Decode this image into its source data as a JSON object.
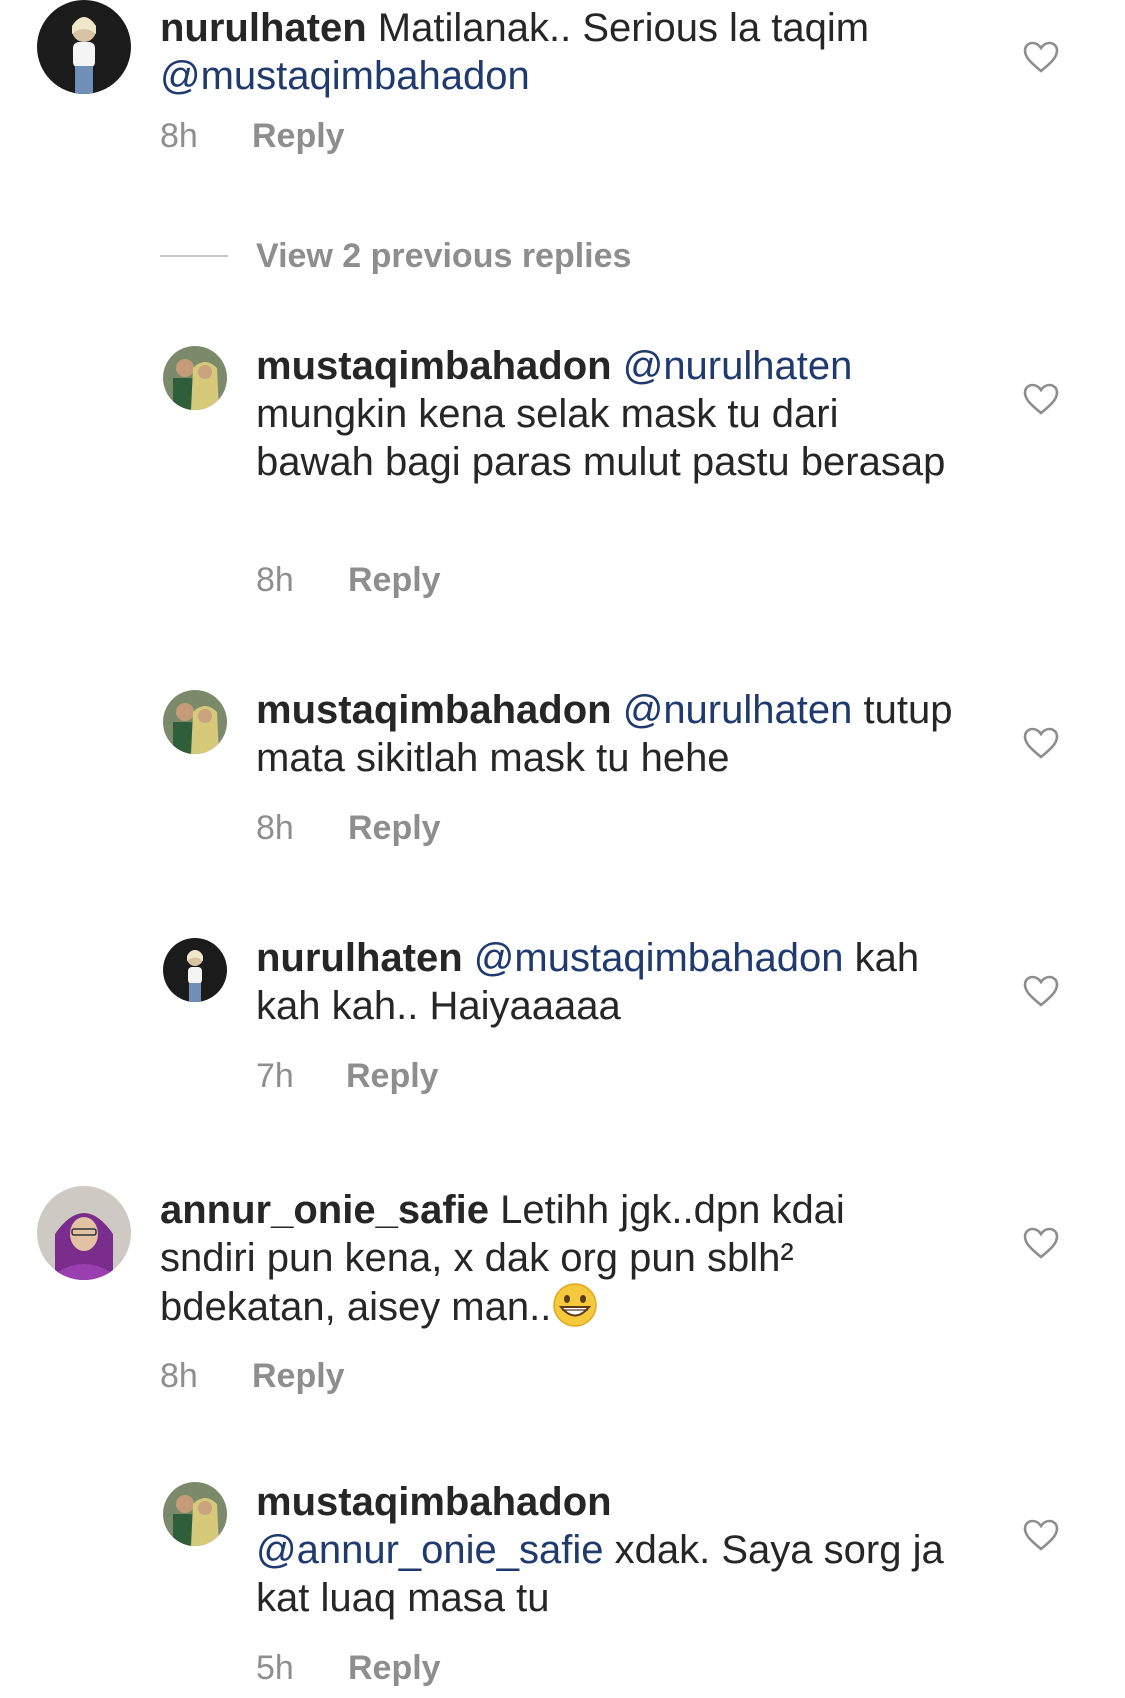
{
  "comments": [
    {
      "user": "nurulhaten",
      "text_before": " Matilanak.. Serious la taqim ",
      "mention": "@mustaqimbahadon",
      "text_after": "",
      "time": "8h",
      "reply": "Reply"
    }
  ],
  "view_previous": "View 2 previous replies",
  "replies": [
    {
      "user": "mustaqimbahadon",
      "mention": " @nurulhaten",
      "text": " mungkin kena selak mask tu dari bawah bagi paras mulut pastu berasap",
      "time": "8h",
      "reply": "Reply"
    },
    {
      "user": "mustaqimbahadon",
      "mention": " @nurulhaten",
      "text": " tutup mata sikitlah mask tu hehe",
      "time": "8h",
      "reply": "Reply"
    },
    {
      "user": "nurulhaten",
      "mention": " @mustaqimbahadon",
      "text": " kah kah kah.. Haiyaaaaa",
      "time": "7h",
      "reply": "Reply"
    }
  ],
  "comment2": {
    "user": "annur_onie_safie",
    "text": " Letihh jgk..dpn kdai sndiri pun kena, x dak org pun sblh² bdekatan, aisey man..",
    "time": "8h",
    "reply": "Reply"
  },
  "reply4": {
    "user": "mustaqimbahadon",
    "mention": "@annur_onie_safie",
    "text": " xdak. Saya sorg ja kat luaq masa tu",
    "time": "5h",
    "reply": "Reply"
  },
  "icons": {
    "like": "heart-outline-icon",
    "emoji": "grinning-face-emoji"
  },
  "colors": {
    "username": "#262626",
    "mention": "#1f3a6e",
    "meta": "#8e8e8e"
  }
}
